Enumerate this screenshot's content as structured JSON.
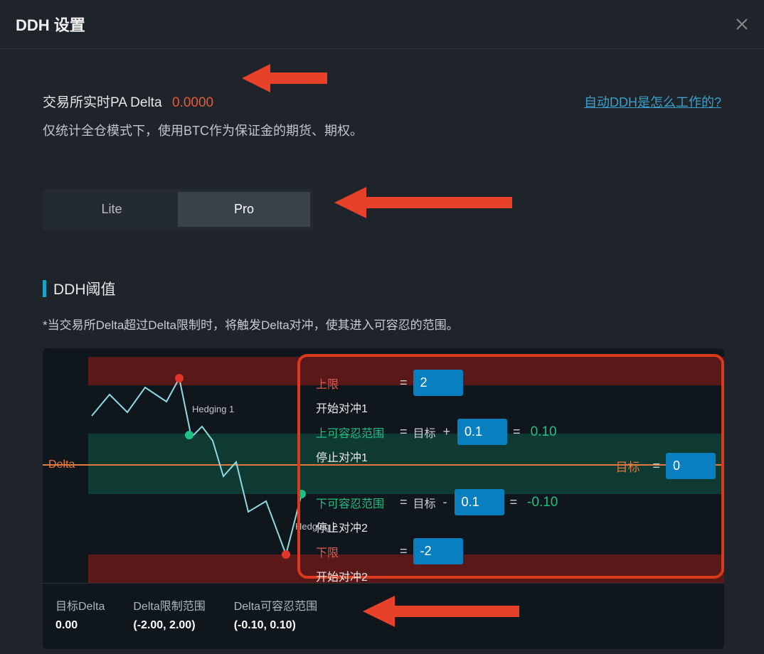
{
  "title": "DDH 设置",
  "pa_delta_label": "交易所实时PA Delta",
  "pa_delta_value": "0.0000",
  "help_link": "自动DDH是怎么工作的?",
  "note": "仅统计全仓模式下，使用BTC作为保证金的期货、期权。",
  "tabs": {
    "lite": "Lite",
    "pro": "Pro"
  },
  "section": {
    "title": "DDH阈值",
    "note": "*当交易所Delta超过Delta限制时，将触发Delta对冲，使其进入可容忍的范围。"
  },
  "chart": {
    "delta_label": "Delta",
    "hedging1": "Hedging 1",
    "hedging2": "Hedging 2"
  },
  "controls": {
    "upper_label": "上限",
    "upper_sub": "开始对冲1",
    "upper_value": "2",
    "upper_tol_label": "上可容忍范围",
    "upper_tol_sub": "停止对冲1",
    "upper_tol_value": "0.1",
    "upper_tol_result": "0.10",
    "lower_tol_label": "下可容忍范围",
    "lower_tol_sub": "停止对冲2",
    "lower_tol_value": "0.1",
    "lower_tol_result": "-0.10",
    "lower_label": "下限",
    "lower_sub": "开始对冲2",
    "lower_value": "-2",
    "eq": "=",
    "plus": "+",
    "minus": "-",
    "target_word": "目标"
  },
  "target": {
    "label": "目标",
    "value": "0"
  },
  "summary": {
    "col1_label": "目标Delta",
    "col1_value": "0.00",
    "col2_label": "Delta限制范围",
    "col2_value": "(-2.00, 2.00)",
    "col3_label": "Delta可容忍范围",
    "col3_value": "(-0.10, 0.10)"
  }
}
